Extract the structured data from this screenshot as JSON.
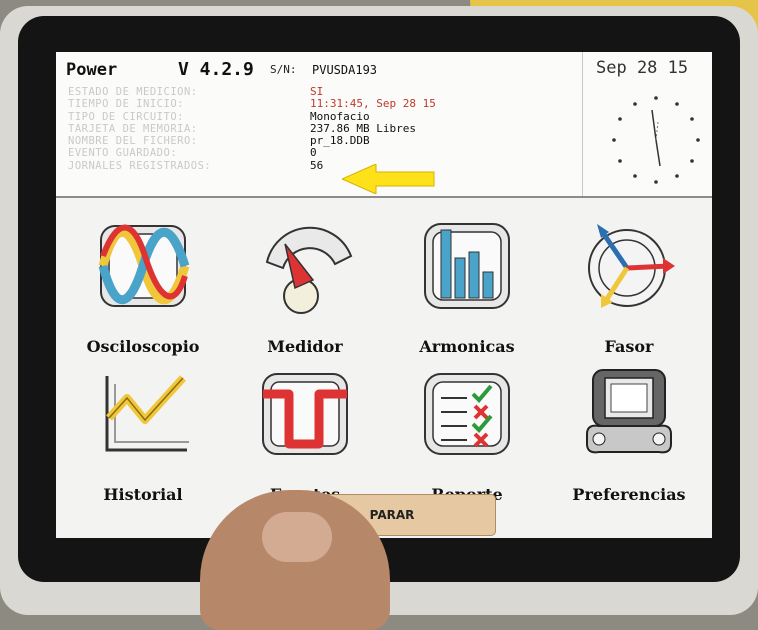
{
  "header": {
    "title": "Power",
    "version": "V 4.2.9",
    "sn_label": "S/N:",
    "sn_value": "PVUSDA193",
    "date": "Sep 28 15"
  },
  "status_rows": [
    {
      "label": "ESTADO DE MEDICION:",
      "value": "SI"
    },
    {
      "label": "TIEMPO DE INICIO:",
      "value": "11:31:45, Sep 28 15"
    },
    {
      "label": "TIPO DE CIRCUITO:",
      "value": "Monofacio"
    },
    {
      "label": "TARJETA DE MEMORIA:",
      "value": "237.86 MB Libres"
    },
    {
      "label": "NOMBRE DEL FICHERO:",
      "value": "pr_18.DDB"
    },
    {
      "label": "EVENTO GUARDADO:",
      "value": "0"
    },
    {
      "label": "JORNALES REGISTRADOS:",
      "value": "56"
    }
  ],
  "apps": [
    {
      "label": "Osciloscopio",
      "icon": "oscilloscope-icon"
    },
    {
      "label": "Medidor",
      "icon": "meter-gauge-icon"
    },
    {
      "label": "Armonicas",
      "icon": "harmonics-bars-icon"
    },
    {
      "label": "Fasor",
      "icon": "phasor-icon"
    },
    {
      "label": "Historial",
      "icon": "history-chart-icon"
    },
    {
      "label": "Eventos",
      "icon": "events-dip-icon"
    },
    {
      "label": "Reporte",
      "icon": "report-checklist-icon"
    },
    {
      "label": "Preferencias",
      "icon": "preferences-wrench-icon"
    }
  ],
  "stop_button": {
    "label": "PARAR"
  },
  "colors": {
    "accent_red": "#c0392b",
    "arrow_yellow": "#ffe11a",
    "button_fill": "#e6c9a2",
    "icon_blue": "#4aa3c8",
    "icon_yellow": "#f0c63a"
  }
}
